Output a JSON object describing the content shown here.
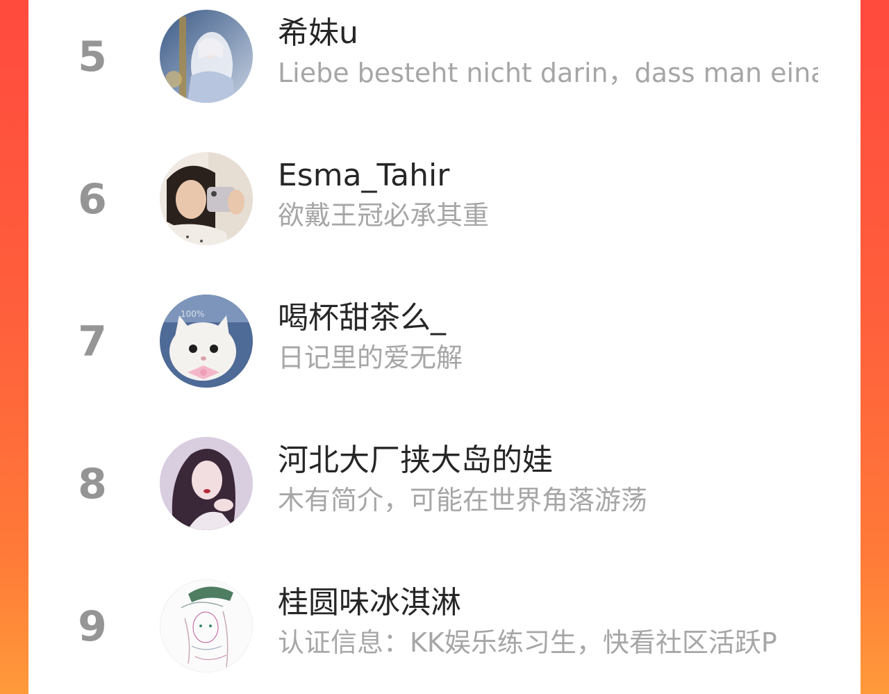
{
  "ranking": {
    "items": [
      {
        "rank": "5",
        "name": "希妹u",
        "description": "Liebe besteht nicht darin，dass man einander ansieht",
        "avatar_icon": "fantasy-figure-avatar"
      },
      {
        "rank": "6",
        "name": "Esma_Tahir",
        "description": "欲戴王冠必承其重",
        "avatar_icon": "selfie-girl-avatar"
      },
      {
        "rank": "7",
        "name": "喝杯甜茶么_",
        "description": "日记里的爱无解",
        "avatar_icon": "white-cat-avatar"
      },
      {
        "rank": "8",
        "name": "河北大厂挟大岛的娃",
        "description": "木有简介，可能在世界角落游荡",
        "avatar_icon": "portrait-girl-avatar"
      },
      {
        "rank": "9",
        "name": "桂圆味冰淇淋",
        "description": "认证信息：KK娱乐练习生，快看社区活跃P",
        "avatar_icon": "sketch-illustration-avatar"
      }
    ]
  },
  "colors": {
    "side_gradient_top": "#ff4a3e",
    "side_gradient_bottom": "#ff9a3a",
    "rank_color": "#959595",
    "name_color": "#262626",
    "desc_color": "#a6a6a6"
  }
}
